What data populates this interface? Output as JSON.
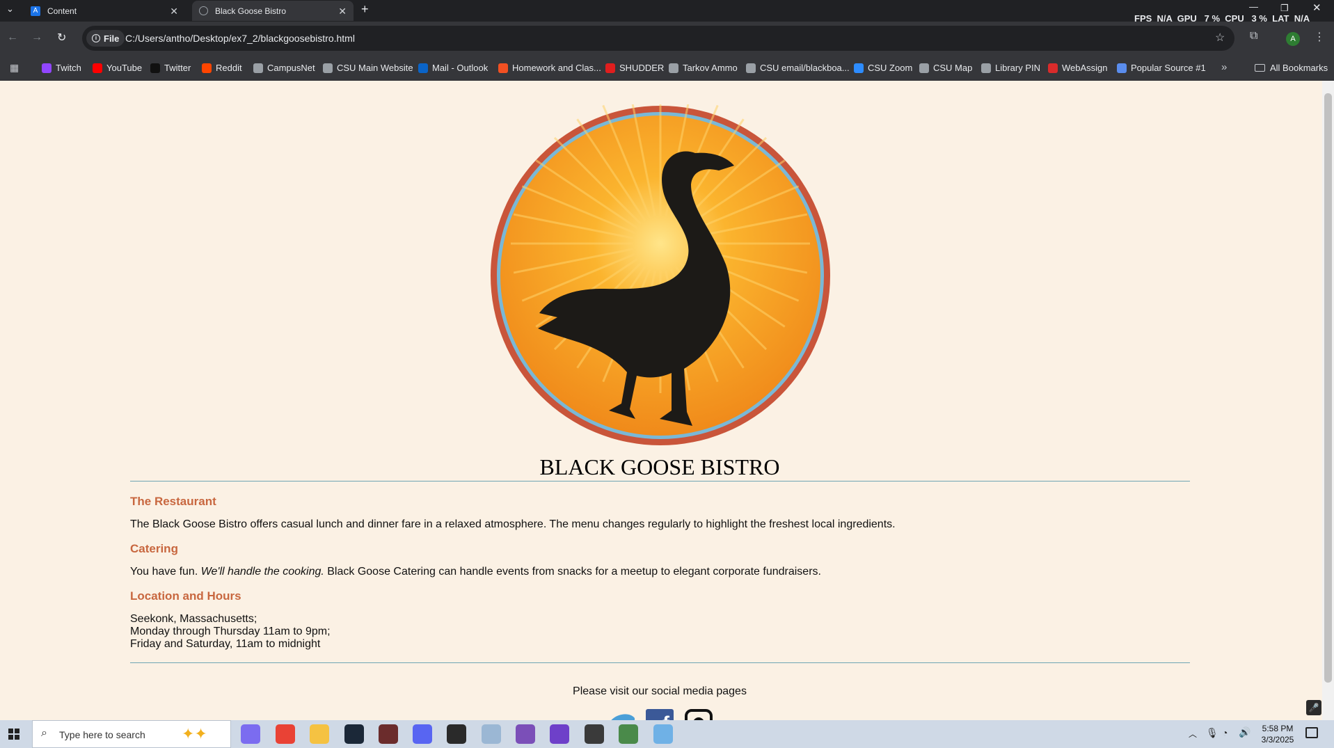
{
  "browser": {
    "tabs": [
      {
        "title": "Content",
        "active": false
      },
      {
        "title": "Black Goose Bistro",
        "active": true
      }
    ],
    "perf_overlay": "FPS  N/A  GPU   7 %  CPU   3 %  LAT  N/A",
    "url_scheme": "File",
    "url": "C:/Users/antho/Desktop/ex7_2/blackgoosebistro.html",
    "profile_initial": "A",
    "bookmarks": [
      {
        "label": "Twitch",
        "color": "#9146ff"
      },
      {
        "label": "YouTube",
        "color": "#ff0000"
      },
      {
        "label": "Twitter",
        "color": "#111111"
      },
      {
        "label": "Reddit",
        "color": "#ff4500"
      },
      {
        "label": "CampusNet",
        "color": "#9aa0a6"
      },
      {
        "label": "CSU Main Website",
        "color": "#9aa0a6"
      },
      {
        "label": "Mail - Outlook",
        "color": "#0a64c8"
      },
      {
        "label": "Homework and Clas...",
        "color": "#f25022"
      },
      {
        "label": "SHUDDER",
        "color": "#e01e1e"
      },
      {
        "label": "Tarkov Ammo",
        "color": "#9aa0a6"
      },
      {
        "label": "CSU email/blackboa...",
        "color": "#9aa0a6"
      },
      {
        "label": "CSU Zoom",
        "color": "#2d8cff"
      },
      {
        "label": "CSU Map",
        "color": "#9aa0a6"
      },
      {
        "label": "Library PIN",
        "color": "#9aa0a6"
      },
      {
        "label": "WebAssign",
        "color": "#d92b2b"
      },
      {
        "label": "Popular Source #1",
        "color": "#5a8dee"
      }
    ],
    "all_bookmarks": "All Bookmarks"
  },
  "page": {
    "title": "BLACK GOOSE BISTRO",
    "sections": [
      {
        "heading": "The Restaurant",
        "text": "The Black Goose Bistro offers casual lunch and dinner fare in a relaxed atmosphere. The menu changes regularly to highlight the freshest local ingredients."
      },
      {
        "heading": "Catering",
        "text_before": "You have fun. ",
        "text_em": "We'll handle the cooking.",
        "text_after": " Black Goose Catering can handle events from snacks for a meetup to elegant corporate fundraisers."
      },
      {
        "heading": "Location and Hours",
        "lines": [
          "Seekonk, Massachusetts;",
          "Monday through Thursday 11am to 9pm;",
          "Friday and Saturday, 11am to midnight"
        ]
      }
    ],
    "footer_text": "Please visit our social media pages",
    "colors": {
      "background": "#fbf1e4",
      "heading": "#c8673f",
      "rule": "#6ea5b3",
      "logo_ring": "#c9553a",
      "logo_sky": "#7ab8d6",
      "logo_sun": "#f4941e"
    }
  },
  "taskbar": {
    "search_placeholder": "Type here to search",
    "time": "5:58 PM",
    "date": "3/3/2025"
  }
}
